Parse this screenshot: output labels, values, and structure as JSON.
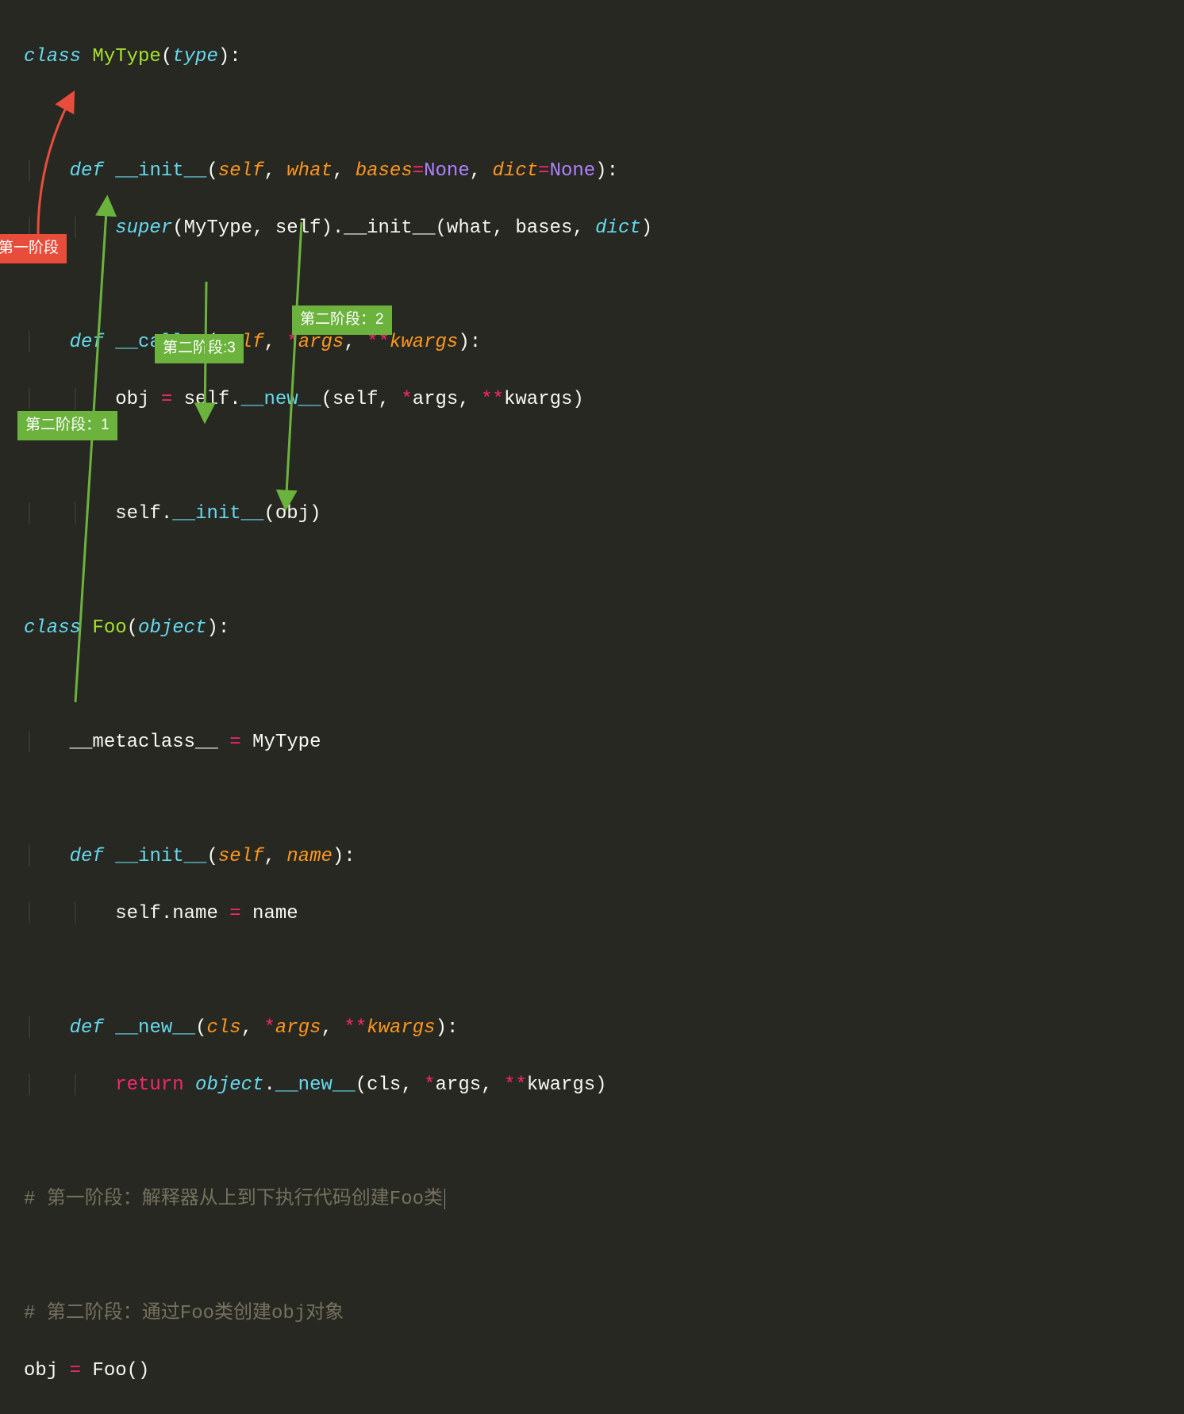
{
  "colors": {
    "background": "#272822",
    "default": "#f8f8f2",
    "keyword": "#66d9ef",
    "classname": "#a6e22e",
    "param": "#fd971f",
    "operator": "#f92672",
    "constant": "#ae81ff",
    "comment": "#75715e",
    "annot_red": "#e84d3c",
    "annot_green": "#6cb33e"
  },
  "code": {
    "l1": {
      "kw": "class",
      "name": "MyType",
      "base": "type"
    },
    "l2": {
      "kw": "def",
      "name": "__init__",
      "p1": "self",
      "p2": "what",
      "p3": "bases",
      "p4": "dict",
      "none": "None"
    },
    "l3": {
      "super": "super",
      "mytype": "MyType",
      "self": "self",
      "init": "__init__",
      "args": "what, bases, ",
      "dict": "dict"
    },
    "l4": {
      "kw": "def",
      "name": "__call__",
      "p1": "self",
      "args": "args",
      "kwargs": "kwargs"
    },
    "l5": {
      "obj": "obj ",
      "self": "self",
      "new": "__new__",
      "rest": "(self, ",
      "args": "args, ",
      "kwargs": "kwargs)"
    },
    "l6": {
      "self": "self",
      "init": "__init__",
      "rest": "(obj)"
    },
    "l7": {
      "kw": "class",
      "name": "Foo",
      "base": "object"
    },
    "l8": {
      "meta": "__metaclass__ ",
      "eq": "=",
      "val": " MyType"
    },
    "l9": {
      "kw": "def",
      "name": "__init__",
      "p1": "self",
      "p2": "name"
    },
    "l10": {
      "self": "self",
      "name": ".name ",
      "eq": "=",
      "rest": " name"
    },
    "l11": {
      "kw": "def",
      "name": "__new__",
      "p1": "cls",
      "args": "args",
      "kwargs": "kwargs"
    },
    "l12": {
      "ret": "return",
      "obj": "object",
      "new": "__new__",
      "rest": "(cls, ",
      "args": "args, ",
      "kwargs": "kwargs)"
    },
    "c1": "# 第一阶段：解释器从上到下执行代码创建Foo类",
    "c2": "# 第二阶段：通过Foo类创建obj对象",
    "l13": {
      "obj": "obj ",
      "eq": "=",
      "foo": " Foo()"
    }
  },
  "annotations": {
    "stage1": "第一阶段",
    "stage2_1": "第二阶段：1",
    "stage2_2": "第二阶段：2",
    "stage2_3": "第二阶段:3"
  }
}
